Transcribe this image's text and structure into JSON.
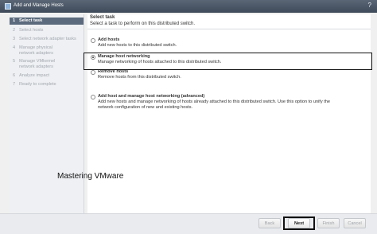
{
  "window": {
    "title": "Add and Manage Hosts",
    "help_icon": "help-icon"
  },
  "steps": [
    {
      "num": "1",
      "label": "Select task"
    },
    {
      "num": "2",
      "label": "Select hosts"
    },
    {
      "num": "3",
      "label": "Select network adapter tasks"
    },
    {
      "num": "4",
      "label": "Manage physical network adapters"
    },
    {
      "num": "5",
      "label": "Manage VMkernel network adapters"
    },
    {
      "num": "6",
      "label": "Analyze impact"
    },
    {
      "num": "7",
      "label": "Ready to complete"
    }
  ],
  "header": {
    "title": "Select task",
    "description": "Select a task to perform on this distributed switch."
  },
  "options": [
    {
      "label": "Add hosts",
      "description": "Add new hosts to this distributed switch.",
      "selected": false
    },
    {
      "label": "Manage host networking",
      "description": "Manage networking of hosts attached to this distributed switch.",
      "selected": true
    },
    {
      "label": "Remove hosts",
      "description": "Remove hosts from this distributed switch.",
      "selected": false
    },
    {
      "label": "Add host and manage host networking (advanced)",
      "description": "Add new hosts and manage networking of hosts already attached to this distributed switch. Use this option to unify the network configuration of new and existing hosts.",
      "selected": false
    }
  ],
  "watermark": "Mastering VMware",
  "footer": {
    "back": "Back",
    "next": "Next",
    "finish": "Finish",
    "cancel": "Cancel"
  }
}
